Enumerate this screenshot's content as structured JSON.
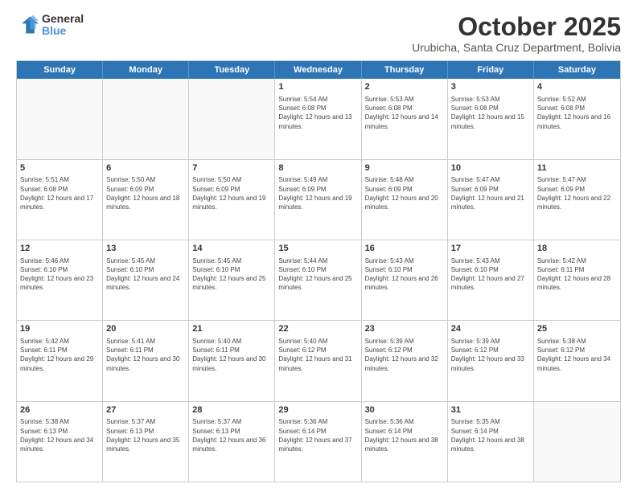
{
  "logo": {
    "general": "General",
    "blue": "Blue"
  },
  "header": {
    "month": "October 2025",
    "location": "Urubicha, Santa Cruz Department, Bolivia"
  },
  "weekdays": [
    "Sunday",
    "Monday",
    "Tuesday",
    "Wednesday",
    "Thursday",
    "Friday",
    "Saturday"
  ],
  "rows": [
    [
      {
        "day": "",
        "info": ""
      },
      {
        "day": "",
        "info": ""
      },
      {
        "day": "",
        "info": ""
      },
      {
        "day": "1",
        "info": "Sunrise: 5:54 AM\nSunset: 6:08 PM\nDaylight: 12 hours and 13 minutes."
      },
      {
        "day": "2",
        "info": "Sunrise: 5:53 AM\nSunset: 6:08 PM\nDaylight: 12 hours and 14 minutes."
      },
      {
        "day": "3",
        "info": "Sunrise: 5:53 AM\nSunset: 6:08 PM\nDaylight: 12 hours and 15 minutes."
      },
      {
        "day": "4",
        "info": "Sunrise: 5:52 AM\nSunset: 6:08 PM\nDaylight: 12 hours and 16 minutes."
      }
    ],
    [
      {
        "day": "5",
        "info": "Sunrise: 5:51 AM\nSunset: 6:08 PM\nDaylight: 12 hours and 17 minutes."
      },
      {
        "day": "6",
        "info": "Sunrise: 5:50 AM\nSunset: 6:09 PM\nDaylight: 12 hours and 18 minutes."
      },
      {
        "day": "7",
        "info": "Sunrise: 5:50 AM\nSunset: 6:09 PM\nDaylight: 12 hours and 19 minutes."
      },
      {
        "day": "8",
        "info": "Sunrise: 5:49 AM\nSunset: 6:09 PM\nDaylight: 12 hours and 19 minutes."
      },
      {
        "day": "9",
        "info": "Sunrise: 5:48 AM\nSunset: 6:09 PM\nDaylight: 12 hours and 20 minutes."
      },
      {
        "day": "10",
        "info": "Sunrise: 5:47 AM\nSunset: 6:09 PM\nDaylight: 12 hours and 21 minutes."
      },
      {
        "day": "11",
        "info": "Sunrise: 5:47 AM\nSunset: 6:09 PM\nDaylight: 12 hours and 22 minutes."
      }
    ],
    [
      {
        "day": "12",
        "info": "Sunrise: 5:46 AM\nSunset: 6:10 PM\nDaylight: 12 hours and 23 minutes."
      },
      {
        "day": "13",
        "info": "Sunrise: 5:45 AM\nSunset: 6:10 PM\nDaylight: 12 hours and 24 minutes."
      },
      {
        "day": "14",
        "info": "Sunrise: 5:45 AM\nSunset: 6:10 PM\nDaylight: 12 hours and 25 minutes."
      },
      {
        "day": "15",
        "info": "Sunrise: 5:44 AM\nSunset: 6:10 PM\nDaylight: 12 hours and 25 minutes."
      },
      {
        "day": "16",
        "info": "Sunrise: 5:43 AM\nSunset: 6:10 PM\nDaylight: 12 hours and 26 minutes."
      },
      {
        "day": "17",
        "info": "Sunrise: 5:43 AM\nSunset: 6:10 PM\nDaylight: 12 hours and 27 minutes."
      },
      {
        "day": "18",
        "info": "Sunrise: 5:42 AM\nSunset: 6:11 PM\nDaylight: 12 hours and 28 minutes."
      }
    ],
    [
      {
        "day": "19",
        "info": "Sunrise: 5:42 AM\nSunset: 6:11 PM\nDaylight: 12 hours and 29 minutes."
      },
      {
        "day": "20",
        "info": "Sunrise: 5:41 AM\nSunset: 6:11 PM\nDaylight: 12 hours and 30 minutes."
      },
      {
        "day": "21",
        "info": "Sunrise: 5:40 AM\nSunset: 6:11 PM\nDaylight: 12 hours and 30 minutes."
      },
      {
        "day": "22",
        "info": "Sunrise: 5:40 AM\nSunset: 6:12 PM\nDaylight: 12 hours and 31 minutes."
      },
      {
        "day": "23",
        "info": "Sunrise: 5:39 AM\nSunset: 6:12 PM\nDaylight: 12 hours and 32 minutes."
      },
      {
        "day": "24",
        "info": "Sunrise: 5:39 AM\nSunset: 6:12 PM\nDaylight: 12 hours and 33 minutes."
      },
      {
        "day": "25",
        "info": "Sunrise: 5:38 AM\nSunset: 6:12 PM\nDaylight: 12 hours and 34 minutes."
      }
    ],
    [
      {
        "day": "26",
        "info": "Sunrise: 5:38 AM\nSunset: 6:13 PM\nDaylight: 12 hours and 34 minutes."
      },
      {
        "day": "27",
        "info": "Sunrise: 5:37 AM\nSunset: 6:13 PM\nDaylight: 12 hours and 35 minutes."
      },
      {
        "day": "28",
        "info": "Sunrise: 5:37 AM\nSunset: 6:13 PM\nDaylight: 12 hours and 36 minutes."
      },
      {
        "day": "29",
        "info": "Sunrise: 5:36 AM\nSunset: 6:14 PM\nDaylight: 12 hours and 37 minutes."
      },
      {
        "day": "30",
        "info": "Sunrise: 5:36 AM\nSunset: 6:14 PM\nDaylight: 12 hours and 38 minutes."
      },
      {
        "day": "31",
        "info": "Sunrise: 5:35 AM\nSunset: 6:14 PM\nDaylight: 12 hours and 38 minutes."
      },
      {
        "day": "",
        "info": ""
      }
    ]
  ]
}
